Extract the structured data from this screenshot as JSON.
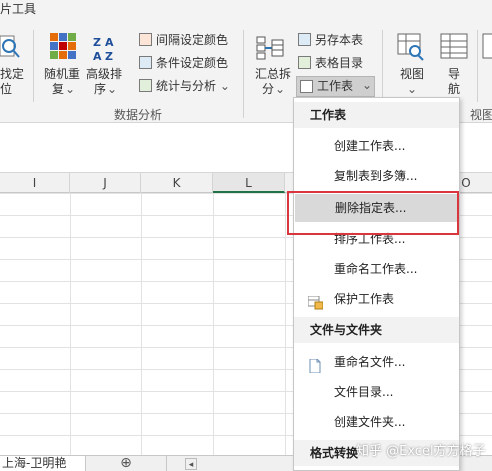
{
  "ribbon": {
    "tab_fragment": "片工具",
    "find_fragment_1": "找定",
    "find_fragment_2": "位",
    "random_label_1": "随机重",
    "random_label_2": "复",
    "sort_label_1": "高级排",
    "sort_label_2": "序",
    "interval_color": "间隔设定颜色",
    "cond_color": "条件设定颜色",
    "stats_analysis": "统计与分析",
    "group_data_analysis": "数据分析",
    "summary_label_1": "汇总拆",
    "summary_label_2": "分",
    "save_table": "另存本表",
    "table_toc": "表格目录",
    "worksheet": "工作表",
    "view_label": "视图",
    "nav_label_1": "导",
    "nav_label_2": "航",
    "group_view_fragment": "视图"
  },
  "columns": [
    "I",
    "J",
    "K",
    "L",
    "O"
  ],
  "sheet_tab": "上海-卫明艳",
  "menu": {
    "header_worksheet": "工作表",
    "items_worksheet": [
      {
        "label": "创建工作表..."
      },
      {
        "label": "复制表到多簿..."
      },
      {
        "label": "删除指定表..."
      },
      {
        "label": "排序工作表..."
      },
      {
        "label": "重命名工作表..."
      },
      {
        "label": "保护工作表"
      }
    ],
    "header_files": "文件与文件夹",
    "items_files": [
      {
        "label": "重命名文件..."
      },
      {
        "label": "文件目录..."
      },
      {
        "label": "创建文件夹..."
      }
    ],
    "header_format": "格式转换"
  },
  "watermark": "知乎 @Excel方方格子",
  "colors": {
    "highlight_box": "#d9363e",
    "menu_hover": "#d9d9d9",
    "ribbon_bg": "#f3f3f3",
    "selected_col": "#217346"
  }
}
